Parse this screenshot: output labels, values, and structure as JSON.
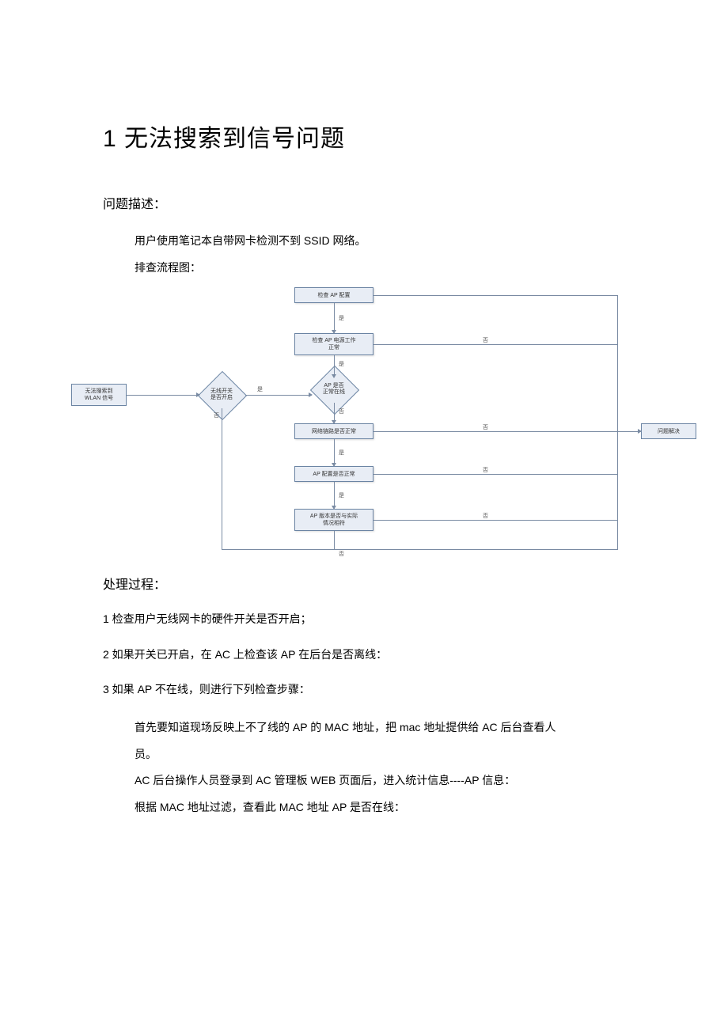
{
  "title": "1 无法搜索到信号问题",
  "section_problem_head": "问题描述：",
  "problem_text": "用户使用笔记本自带网卡检测不到 SSID 网络。",
  "flow_label": "排查流程图：",
  "section_process_head": "处理过程：",
  "steps": {
    "s1": "1 检查用户无线网卡的硬件开关是否开启；",
    "s2": "2 如果开关已开启，在 AC 上检查该 AP 在后台是否离线：",
    "s3": "3 如果 AP 不在线，则进行下列检查步骤：",
    "s3a": "首先要知道现场反映上不了线的 AP 的 MAC 地址，把 mac 地址提供给 AC 后台查看人",
    "s3a2": "员。",
    "s3b": "AC 后台操作人员登录到 AC 管理板 WEB 页面后，进入统计信息----AP 信息：",
    "s3c": "根据 MAC 地址过滤，查看此 MAC 地址 AP 是否在线："
  },
  "flow": {
    "start": "无法搜索到\nWLAN  信号",
    "d_switch": "无线开关\n是否开启",
    "n_check_ap": "检查  AP 配置",
    "n_ap_port": "检查  AP 电源工作\n正常",
    "d_online": "AP 是否\n正常在线",
    "n_link": "网络链路是否正常",
    "n_cfg": "AP 配置是否正常",
    "n_ver": "AP 版本是否与实际\n情况相符",
    "end": "问题解决",
    "yes": "是",
    "no": "否"
  }
}
